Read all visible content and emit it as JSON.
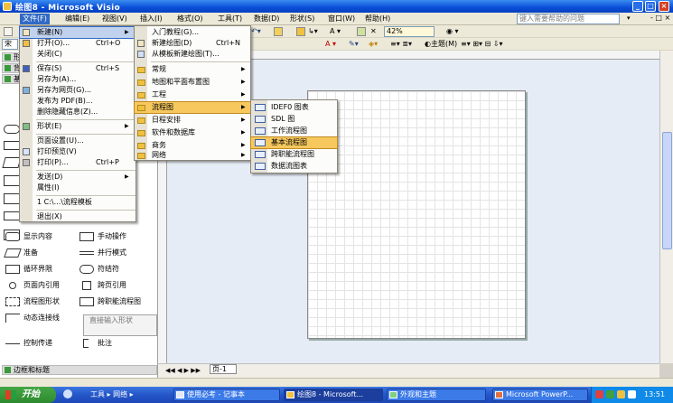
{
  "window": {
    "title": "绘图8 - Microsoft Visio"
  },
  "menubar": {
    "items": [
      "文件(F)",
      "编辑(E)",
      "视图(V)",
      "插入(I)",
      "格式(O)",
      "工具(T)",
      "数据(D)",
      "形状(S)",
      "窗口(W)",
      "帮助(H)"
    ],
    "help_placeholder": "键入需要帮助的问题"
  },
  "toolbar": {
    "zoom": "42%",
    "font_size": "宋",
    "theme_label": "主题(M)"
  },
  "file_menu": {
    "items": [
      {
        "label": "新建(N)",
        "shortcut": "",
        "arrow": "▶"
      },
      {
        "label": "打开(O)...",
        "shortcut": "Ctrl+O",
        "arrow": ""
      },
      {
        "label": "关闭(C)",
        "shortcut": "",
        "arrow": ""
      },
      {
        "label": "保存(S)",
        "shortcut": "Ctrl+S",
        "arrow": ""
      },
      {
        "label": "另存为(A)...",
        "shortcut": "",
        "arrow": ""
      },
      {
        "label": "另存为网页(G)...",
        "shortcut": "",
        "arrow": ""
      },
      {
        "label": "发布为 PDF(B)...",
        "shortcut": "",
        "arrow": ""
      },
      {
        "label": "删除隐藏信息(Z)...",
        "shortcut": "",
        "arrow": ""
      },
      {
        "label": "形状(E)",
        "shortcut": "",
        "arrow": "▶"
      },
      {
        "label": "页面设置(U)...",
        "shortcut": "",
        "arrow": ""
      },
      {
        "label": "打印预览(V)",
        "shortcut": "",
        "arrow": ""
      },
      {
        "label": "打印(P)...",
        "shortcut": "Ctrl+P",
        "arrow": ""
      },
      {
        "label": "发送(D)",
        "shortcut": "",
        "arrow": "▶"
      },
      {
        "label": "属性(I)",
        "shortcut": "",
        "arrow": ""
      },
      {
        "label": "1 C:\\...\\流程模板",
        "shortcut": "",
        "arrow": ""
      },
      {
        "label": "退出(X)",
        "shortcut": "",
        "arrow": ""
      }
    ]
  },
  "new_menu": {
    "items": [
      {
        "label": "入门教程(G)...",
        "shortcut": "",
        "arrow": ""
      },
      {
        "label": "新建绘图(D)",
        "shortcut": "Ctrl+N",
        "arrow": ""
      },
      {
        "label": "从模板新建绘图(T)...",
        "shortcut": "",
        "arrow": ""
      },
      {
        "label": "常规",
        "shortcut": "",
        "arrow": "▶"
      },
      {
        "label": "地图和平面布置图",
        "shortcut": "",
        "arrow": "▶"
      },
      {
        "label": "工程",
        "shortcut": "",
        "arrow": "▶"
      },
      {
        "label": "流程图",
        "shortcut": "",
        "arrow": "▶"
      },
      {
        "label": "日程安排",
        "shortcut": "",
        "arrow": "▶"
      },
      {
        "label": "软件和数据库",
        "shortcut": "",
        "arrow": "▶"
      },
      {
        "label": "商务",
        "shortcut": "",
        "arrow": "▶"
      },
      {
        "label": "网络",
        "shortcut": "",
        "arrow": "▶"
      }
    ]
  },
  "flowchart_menu": {
    "items": [
      "IDEF0 图表",
      "SDL 图",
      "工作流程图",
      "基本流程图",
      "跨职能流程图",
      "数据流图表"
    ]
  },
  "shapes_panel": {
    "headers": [
      "形",
      "背景",
      "基本",
      "边框和标题"
    ],
    "shapes": [
      {
        "left": "显示内容",
        "right": "手动操作"
      },
      {
        "left": "准备",
        "right": "并行模式"
      },
      {
        "left": "循环界限",
        "right": "符结符"
      },
      {
        "left": "页面内引用",
        "right": "跨页引用"
      },
      {
        "left": "流程图形状",
        "right": "跨职能流程图"
      },
      {
        "left": "动态连接线",
        "right": ""
      },
      {
        "left": "控制传递",
        "right": "批注"
      }
    ],
    "tooltip": "直接输入形状"
  },
  "page_tab": "页-1",
  "taskbar": {
    "start": "开始",
    "tools": "工具 ▸ 网络 ▸",
    "tasks": [
      "使用必考 - 记事本",
      "绘图8 - Microsoft...",
      "外观和主题",
      "Microsoft PowerP..."
    ],
    "clock": "13:51"
  }
}
